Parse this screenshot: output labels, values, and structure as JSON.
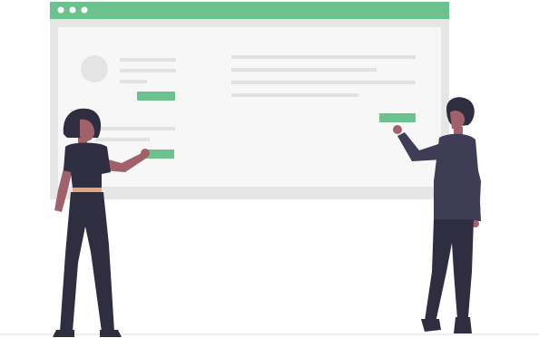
{
  "colors": {
    "background": "#ffffff",
    "accent_green": "#6cc28e",
    "window_frame": "#e6e6e6",
    "window_panel": "#f6f6f6",
    "placeholder_line": "#e2e2e2",
    "avatar": "#e4e4e4",
    "figure_dark": "#2f2e41",
    "figure_clothing_dark": "#3f3d56",
    "skin_tone": "#a0616a",
    "belt": "#e1a57c",
    "ground": "#ededed"
  },
  "window": {
    "titlebar_dots": 3
  },
  "icons": [
    "window-dot-icon",
    "avatar-placeholder-icon"
  ]
}
